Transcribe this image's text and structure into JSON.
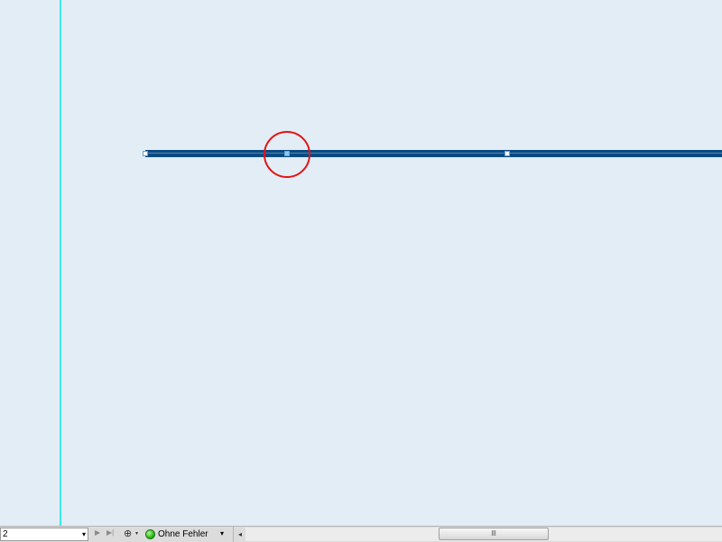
{
  "statusbar": {
    "page_number": "2",
    "nav_next_icon": "▶",
    "nav_last_icon": "▶|",
    "doc_icon": "⊕",
    "status_text": "Ohne Fehler",
    "status_color": "#22a814",
    "dropdown_icon": "▾",
    "scroll_left_icon": "◂",
    "scroll_grip": "lll"
  },
  "canvas": {
    "background": "#e2edf6",
    "guide_color": "#3de8e6",
    "path_color": "#0b4a80",
    "highlight_color": "#e01515"
  }
}
